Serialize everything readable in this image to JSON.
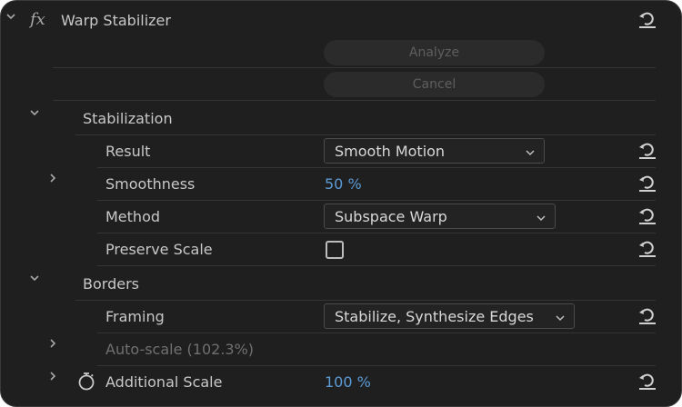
{
  "effect": {
    "fx_symbol": "fx",
    "title": "Warp Stabilizer",
    "analyze_label": "Analyze",
    "cancel_label": "Cancel"
  },
  "stabilization": {
    "section_label": "Stabilization",
    "result_label": "Result",
    "result_value": "Smooth Motion",
    "smoothness_label": "Smoothness",
    "smoothness_value": "50 %",
    "method_label": "Method",
    "method_value": "Subspace Warp",
    "preserve_scale_label": "Preserve Scale",
    "preserve_scale_checked": false
  },
  "borders": {
    "section_label": "Borders",
    "framing_label": "Framing",
    "framing_value": "Stabilize, Synthesize Edges",
    "autoscale_label": "Auto-scale (102.3%)",
    "additional_scale_label": "Additional Scale",
    "additional_scale_value": "100 %"
  },
  "colors": {
    "background": "#1f1f1f",
    "text": "#c8c8c8",
    "value_blue": "#5b9bd5",
    "disabled": "#707070"
  },
  "icons": {
    "reset": "reset-icon",
    "expand": "chevron-down-icon",
    "collapse": "chevron-right-icon",
    "stopwatch": "stopwatch-icon"
  }
}
